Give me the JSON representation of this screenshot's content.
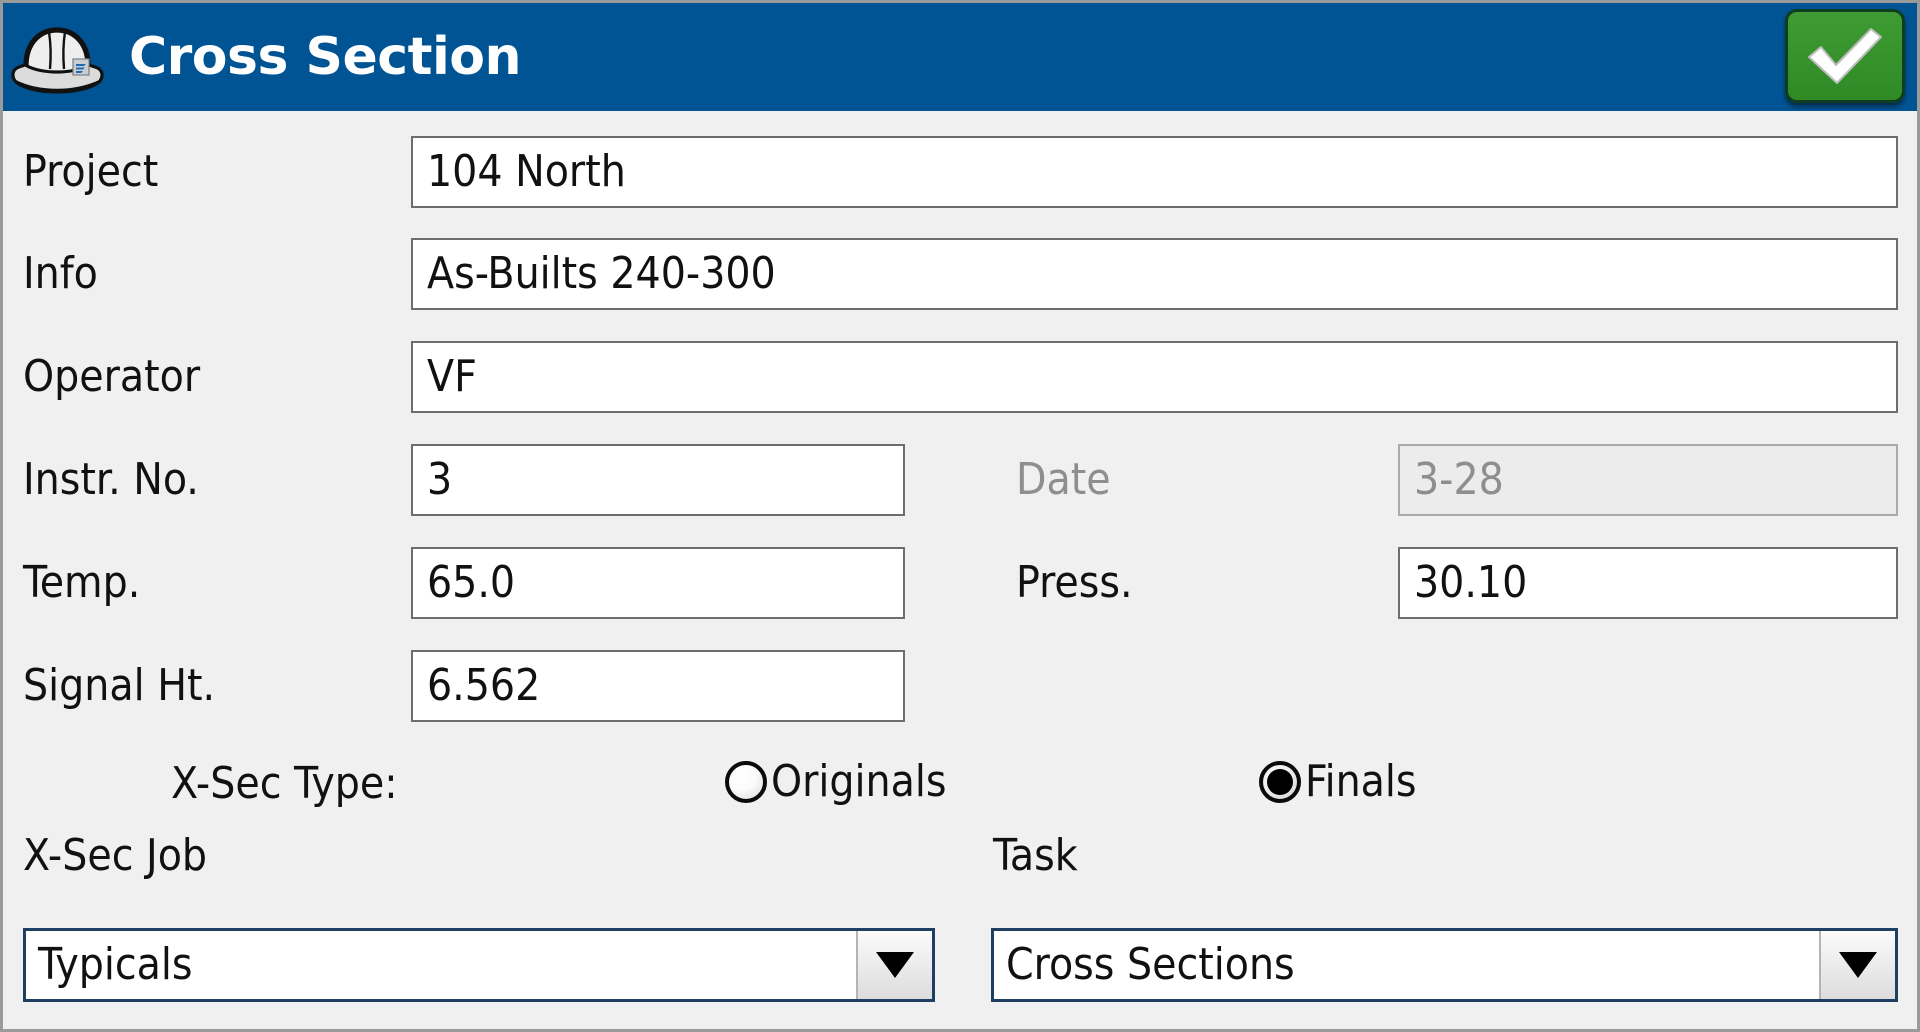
{
  "window": {
    "title": "Cross Section",
    "icon": "hard-hat-icon",
    "header_color": "#015494",
    "confirm_button": {
      "icon": "checkmark-icon",
      "color": "#2f8a26"
    }
  },
  "form": {
    "fields": [
      {
        "label": "Project",
        "value": "104 North",
        "disabled": false
      },
      {
        "label": "Info",
        "value": "As-Builts 240-300",
        "disabled": false
      },
      {
        "label": "Operator",
        "value": "VF",
        "disabled": false
      },
      {
        "label": "Instr. No.",
        "value": "3",
        "disabled": false
      },
      {
        "label": "Date",
        "value": "3-28",
        "disabled": true
      },
      {
        "label": "Temp.",
        "value": "65.0",
        "disabled": false
      },
      {
        "label": "Press.",
        "value": "30.10",
        "disabled": false
      },
      {
        "label": "Signal Ht.",
        "value": "6.562",
        "disabled": false
      }
    ],
    "xsec_type": {
      "label": "X-Sec Type:",
      "options": [
        {
          "label": "Originals",
          "selected": false
        },
        {
          "label": "Finals",
          "selected": true
        }
      ]
    },
    "xsec_job": {
      "label": "X-Sec Job",
      "value": "Typicals",
      "arrow_icon": "chevron-down-icon"
    },
    "task": {
      "label": "Task",
      "value": "Cross Sections",
      "arrow_icon": "chevron-down-icon"
    }
  }
}
